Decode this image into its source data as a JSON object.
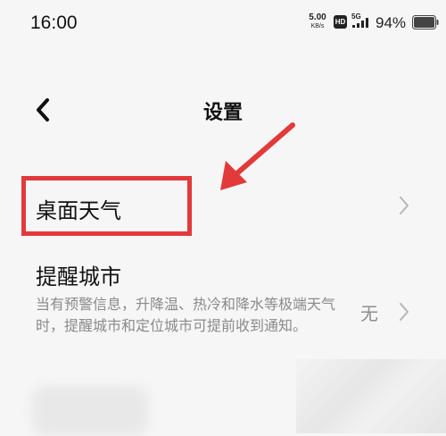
{
  "status_bar": {
    "time": "16:00",
    "net_speed_value": "5.00",
    "net_speed_unit": "KB/s",
    "hd_badge": "HD",
    "network": "5G",
    "battery": "94%",
    "icons": [
      "signal-icon",
      "battery-icon"
    ]
  },
  "header": {
    "back_icon": "chevron-left-icon",
    "title": "设置"
  },
  "settings": {
    "desktop_weather": {
      "label": "桌面天气",
      "chevron_icon": "chevron-right-icon"
    },
    "reminder_city": {
      "label": "提醒城市",
      "description": "当有预警信息，升降温、热冷和降水等极端天气时，提醒城市和定位城市可提前收到通知。",
      "value": "无",
      "chevron_icon": "chevron-right-icon"
    }
  },
  "annotation": {
    "color": "#e23a3a"
  }
}
